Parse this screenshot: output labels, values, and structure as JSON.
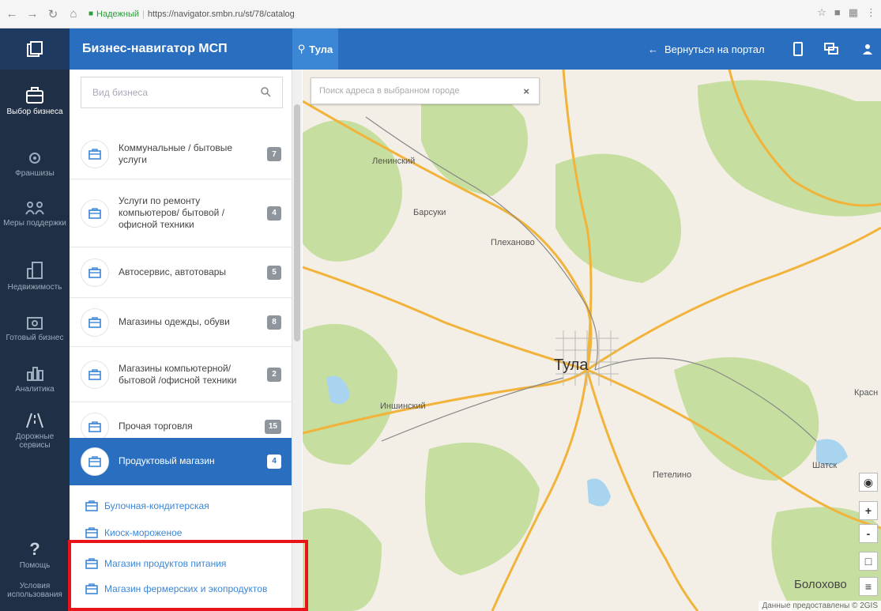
{
  "browser": {
    "secure_label": "Надежный",
    "url": "https://navigator.smbn.ru/st/78/catalog"
  },
  "appbar": {
    "title": "Бизнес-навигатор МСП",
    "city": "Тула",
    "back_label": "Вернуться на портал"
  },
  "sidebar": {
    "items": [
      {
        "label": "Выбор бизнеса",
        "icon": "briefcase-icon"
      },
      {
        "label": "Франшизы",
        "icon": "gear-icon"
      },
      {
        "label": "Меры поддержки",
        "icon": "people-icon"
      },
      {
        "label": "Недвижимость",
        "icon": "building-icon"
      },
      {
        "label": "Готовый бизнес",
        "icon": "case-icon"
      },
      {
        "label": "Аналитика",
        "icon": "chart-icon"
      },
      {
        "label": "Дорожные сервисы",
        "icon": "road-icon"
      },
      {
        "label": "Помощь",
        "icon": "question-icon"
      },
      {
        "label": "Условия использования",
        "icon": "terms-icon"
      }
    ]
  },
  "catalog": {
    "search_placeholder": "Вид бизнеса",
    "categories": [
      {
        "label": "Коммунальные / бытовые услуги",
        "count": "7"
      },
      {
        "label": "Услуги по ремонту компьютеров/ бытовой / офисной техники",
        "count": "4"
      },
      {
        "label": "Автосервис, автотовары",
        "count": "5"
      },
      {
        "label": "Магазины одежды, обуви",
        "count": "8"
      },
      {
        "label": "Магазины компьютерной/ бытовой /офисной техники",
        "count": "2"
      },
      {
        "label": "Прочая торговля",
        "count": "15"
      },
      {
        "label": "Продуктовый магазин",
        "count": "4"
      }
    ],
    "subitems": [
      "Булочная-кондитерская",
      "Киоск-мороженое",
      "Магазин продуктов питания",
      "Магазин фермерских и экопродуктов"
    ]
  },
  "map": {
    "search_placeholder": "Поиск адреса в выбранном городе",
    "labels": {
      "leninsky": "Ленинский",
      "barsuki": "Барсуки",
      "plekhanovo": "Плеханово",
      "tula": "Тула",
      "inshinsky": "Иншинский",
      "petelino": "Петелино",
      "shatsk": "Шатск",
      "krasn": "Красн",
      "bolokhovo": "Болохово"
    },
    "attribution": "Данные предоставлены © 2GIS"
  },
  "colors": {
    "brand_blue": "#2a6fbf",
    "sidebar_dark": "#1f2f45",
    "highlight_red": "#e8141a"
  }
}
